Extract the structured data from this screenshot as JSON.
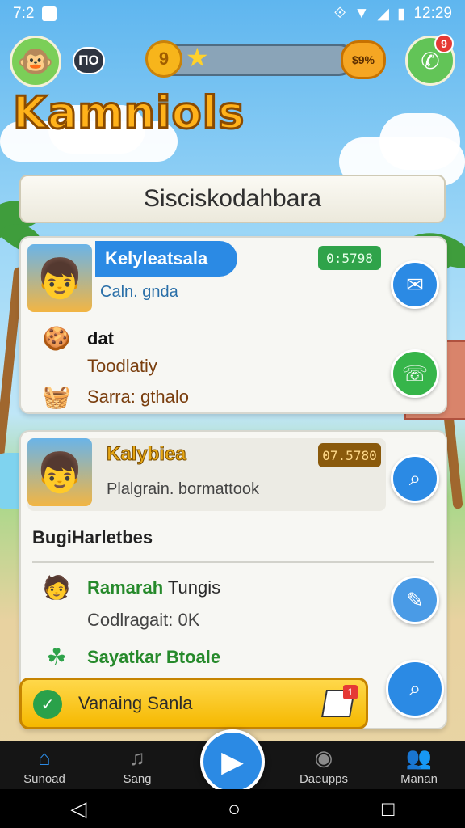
{
  "status_bar": {
    "time_left": "7:2",
    "time_right": "12:29"
  },
  "top_bar": {
    "level_label": "ΠΟ",
    "coin_glyph": "9",
    "xp_badge_label": "$9%",
    "notification_count": "9"
  },
  "game_title": "Kamniols",
  "section_header": "Sisciskodahbara",
  "card1": {
    "name": "Kelyleatsala",
    "subtitle": "Caln. gnda",
    "time": "0:5798",
    "rows": [
      {
        "icon": "crumpled-paper-icon",
        "text": "dat"
      },
      {
        "icon": "",
        "text": "Toodlatiy"
      },
      {
        "icon": "basket-icon",
        "text": "Sarra: gthalo"
      }
    ]
  },
  "card2": {
    "name": "Kalybiea",
    "subtitle": "Plalgrain. bormattook",
    "time": "07.5780",
    "section_label": "BugiHarletbes",
    "rows": [
      {
        "icon": "person-icon",
        "text": "Ramarah",
        "text2": "Tungis"
      },
      {
        "icon": "",
        "text": "Codlragait: 0K"
      },
      {
        "icon": "leaf-icon",
        "text": "Sayatkar Btoale"
      }
    ]
  },
  "cta": {
    "label": "Vanaing Sanla",
    "badge": "1"
  },
  "bottom_nav": [
    {
      "label": "Sunoad",
      "icon": "home-icon"
    },
    {
      "label": "Sang",
      "icon": "headphones-icon"
    },
    {
      "label": "Daeupps",
      "icon": "circle-icon"
    },
    {
      "label": "Manan",
      "icon": "people-icon"
    }
  ],
  "colors": {
    "primary_blue": "#2b8ae4",
    "green": "#36b54a",
    "gold": "#f5b800"
  }
}
